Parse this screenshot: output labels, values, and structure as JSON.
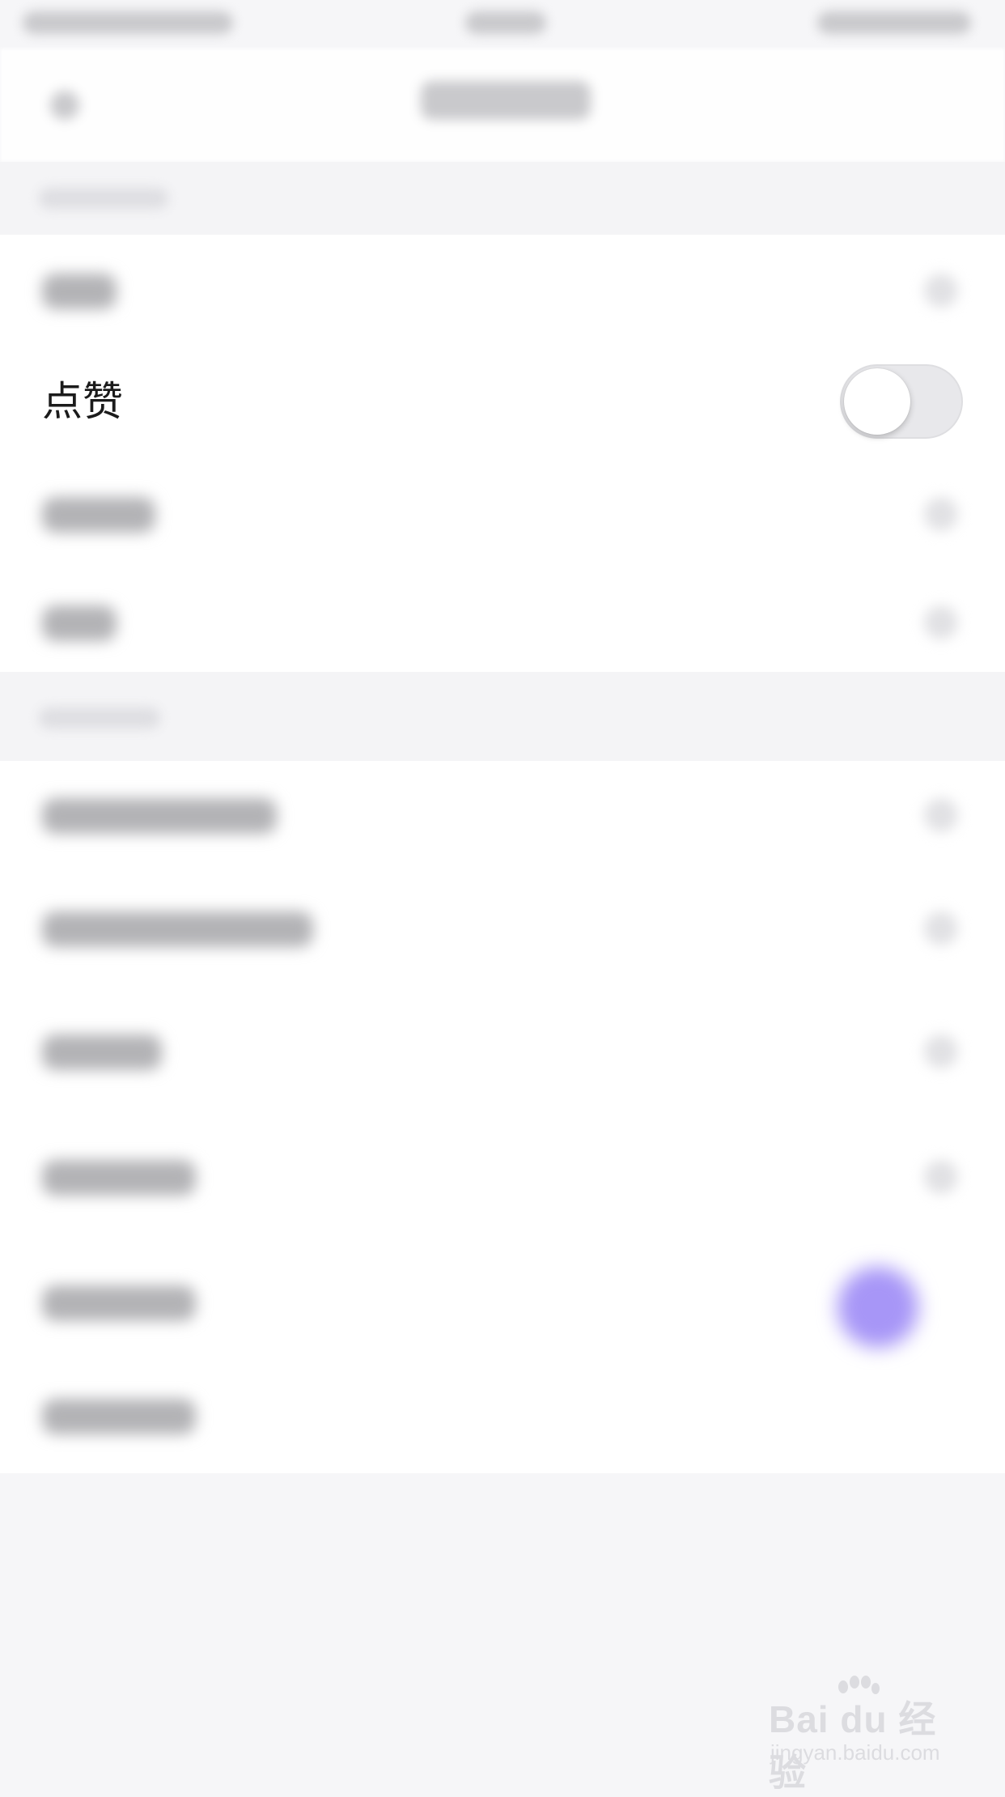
{
  "like_row": {
    "label": "点赞",
    "toggle_on": false
  },
  "watermark": {
    "logo": "Bai du 经验",
    "url": "jingyan.baidu.com"
  },
  "colors": {
    "background": "#f6f6f8",
    "toggle_off_track": "#e8e8eb",
    "blurred_accent": "#a796f7"
  }
}
